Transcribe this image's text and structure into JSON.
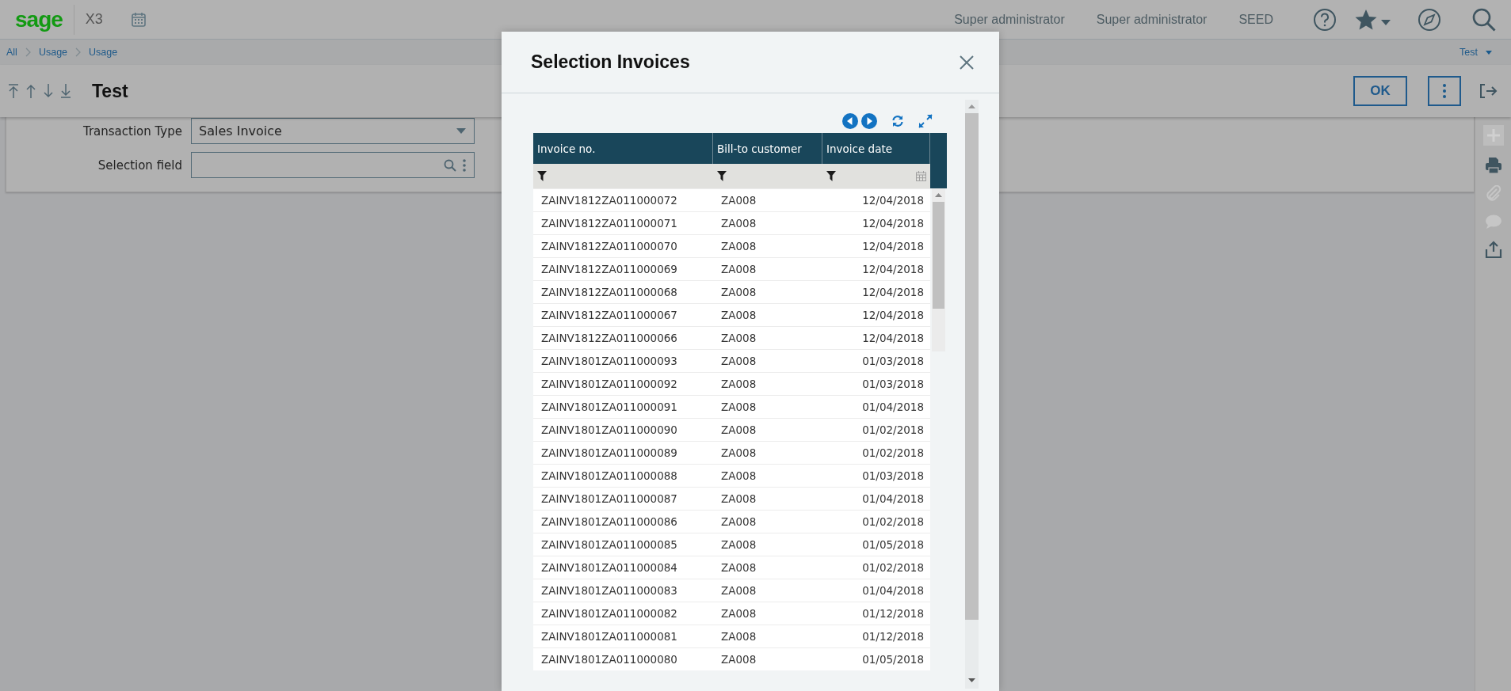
{
  "topbar": {
    "logo": "sage",
    "product": "X3",
    "user_items": [
      "Super administrator",
      "Super administrator",
      "SEED"
    ]
  },
  "breadcrumb": {
    "items": [
      "All",
      "Usage",
      "Usage"
    ],
    "context": "Test"
  },
  "page": {
    "title": "Test",
    "ok_button": "OK"
  },
  "form": {
    "fields": [
      {
        "label": "Transaction Type",
        "kind": "dropdown",
        "value": "Sales Invoice"
      },
      {
        "label": "Selection field",
        "kind": "lookup"
      }
    ]
  },
  "sidebar": {
    "items": [
      {
        "kind": "add",
        "disabled": true
      },
      {
        "kind": "print",
        "disabled": false
      },
      {
        "kind": "attach",
        "disabled": true
      },
      {
        "kind": "comment",
        "disabled": true
      },
      {
        "kind": "export",
        "disabled": false
      }
    ]
  },
  "dialog": {
    "title": "Selection Invoices",
    "table": {
      "columns": [
        {
          "label": "Invoice no.",
          "kind": "text"
        },
        {
          "label": "Bill-to customer",
          "kind": "text"
        },
        {
          "label": "Invoice date",
          "kind": "date"
        }
      ],
      "rows": [
        [
          "ZAINV1812ZA011000072",
          "ZA008",
          "12/04/2018"
        ],
        [
          "ZAINV1812ZA011000071",
          "ZA008",
          "12/04/2018"
        ],
        [
          "ZAINV1812ZA011000070",
          "ZA008",
          "12/04/2018"
        ],
        [
          "ZAINV1812ZA011000069",
          "ZA008",
          "12/04/2018"
        ],
        [
          "ZAINV1812ZA011000068",
          "ZA008",
          "12/04/2018"
        ],
        [
          "ZAINV1812ZA011000067",
          "ZA008",
          "12/04/2018"
        ],
        [
          "ZAINV1812ZA011000066",
          "ZA008",
          "12/04/2018"
        ],
        [
          "ZAINV1801ZA011000093",
          "ZA008",
          "01/03/2018"
        ],
        [
          "ZAINV1801ZA011000092",
          "ZA008",
          "01/03/2018"
        ],
        [
          "ZAINV1801ZA011000091",
          "ZA008",
          "01/04/2018"
        ],
        [
          "ZAINV1801ZA011000090",
          "ZA008",
          "01/02/2018"
        ],
        [
          "ZAINV1801ZA011000089",
          "ZA008",
          "01/02/2018"
        ],
        [
          "ZAINV1801ZA011000088",
          "ZA008",
          "01/03/2018"
        ],
        [
          "ZAINV1801ZA011000087",
          "ZA008",
          "01/04/2018"
        ],
        [
          "ZAINV1801ZA011000086",
          "ZA008",
          "01/02/2018"
        ],
        [
          "ZAINV1801ZA011000085",
          "ZA008",
          "01/05/2018"
        ],
        [
          "ZAINV1801ZA011000084",
          "ZA008",
          "01/02/2018"
        ],
        [
          "ZAINV1801ZA011000083",
          "ZA008",
          "01/04/2018"
        ],
        [
          "ZAINV1801ZA011000082",
          "ZA008",
          "01/12/2018"
        ],
        [
          "ZAINV1801ZA011000081",
          "ZA008",
          "01/12/2018"
        ],
        [
          "ZAINV1801ZA011000080",
          "ZA008",
          "01/05/2018"
        ]
      ]
    }
  }
}
